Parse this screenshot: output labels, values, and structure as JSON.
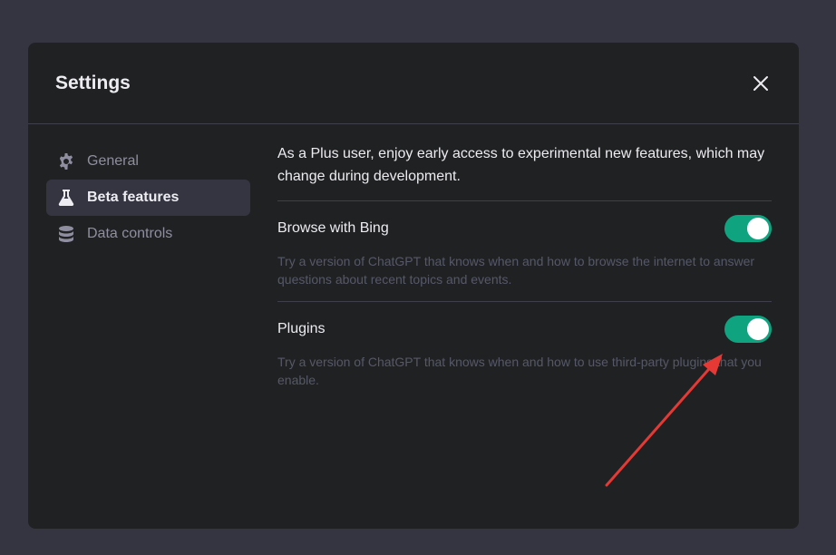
{
  "modal": {
    "title": "Settings",
    "close_icon": "close-icon"
  },
  "sidebar": {
    "items": [
      {
        "label": "General",
        "icon": "gear-icon",
        "active": false
      },
      {
        "label": "Beta features",
        "icon": "flask-icon",
        "active": true
      },
      {
        "label": "Data controls",
        "icon": "database-icon",
        "active": false
      }
    ]
  },
  "content": {
    "intro": "As a Plus user, enjoy early access to experimental new features, which may change during development.",
    "features": [
      {
        "title": "Browse with Bing",
        "description": "Try a version of ChatGPT that knows when and how to browse the internet to answer questions about recent topics and events.",
        "enabled": true
      },
      {
        "title": "Plugins",
        "description": "Try a version of ChatGPT that knows when and how to use third-party plugins that you enable.",
        "enabled": true
      }
    ]
  },
  "colors": {
    "background": "#343541",
    "modal": "#202123",
    "toggle_on": "#10a37f",
    "annotation_arrow": "#e53935"
  }
}
